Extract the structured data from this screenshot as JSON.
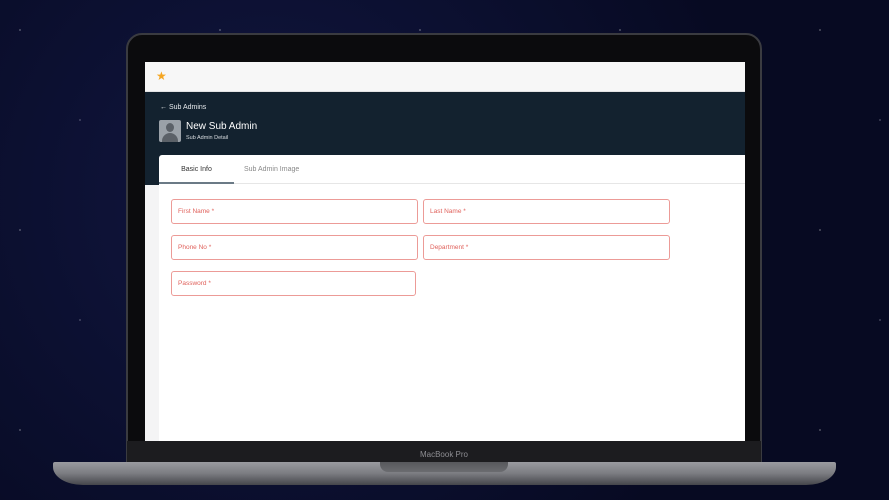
{
  "device": {
    "label": "MacBook Pro"
  },
  "header": {
    "back_label": "Sub Admins",
    "title": "New Sub Admin",
    "subtitle": "Sub Admin Detail"
  },
  "tabs": [
    {
      "label": "Basic Info",
      "active": true
    },
    {
      "label": "Sub Admin Image",
      "active": false
    }
  ],
  "form": {
    "first_name": "First Name *",
    "last_name": "Last Name *",
    "phone": "Phone No *",
    "department": "Department *",
    "password": "Password *"
  },
  "colors": {
    "header": "#13222f",
    "error": "#e0625c",
    "star": "#f5a623"
  }
}
